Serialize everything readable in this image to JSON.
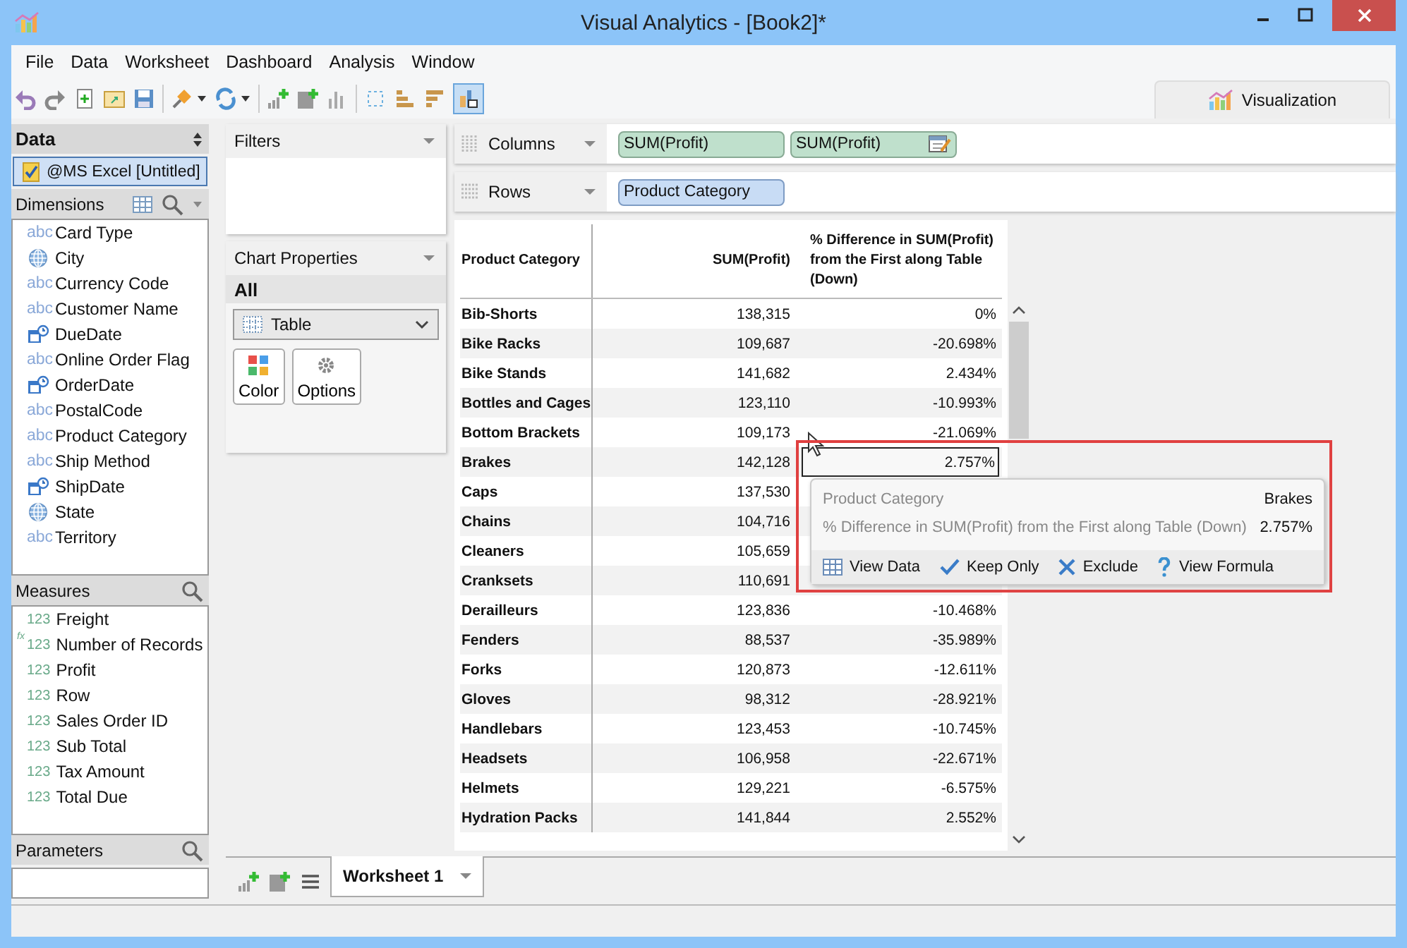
{
  "window": {
    "title": "Visual Analytics - [Book2]*"
  },
  "menu": [
    "File",
    "Data",
    "Worksheet",
    "Dashboard",
    "Analysis",
    "Window"
  ],
  "visualization_tab": {
    "label": "Visualization"
  },
  "data_panel": {
    "title": "Data",
    "source": {
      "label": "@MS Excel [Untitled]",
      "checked": true
    }
  },
  "dimensions": {
    "title": "Dimensions",
    "items": [
      {
        "label": "Card Type",
        "kind": "text",
        "type_text": "abc"
      },
      {
        "label": "City",
        "kind": "geo"
      },
      {
        "label": "Currency Code",
        "kind": "text",
        "type_text": "abc"
      },
      {
        "label": "Customer Name",
        "kind": "text",
        "type_text": "abc"
      },
      {
        "label": "DueDate",
        "kind": "date"
      },
      {
        "label": "Online Order Flag",
        "kind": "text",
        "type_text": "abc"
      },
      {
        "label": "OrderDate",
        "kind": "date"
      },
      {
        "label": "PostalCode",
        "kind": "text",
        "type_text": "abc"
      },
      {
        "label": "Product Category",
        "kind": "text",
        "type_text": "abc"
      },
      {
        "label": "Ship Method",
        "kind": "text",
        "type_text": "abc"
      },
      {
        "label": "ShipDate",
        "kind": "date"
      },
      {
        "label": "State",
        "kind": "geo"
      },
      {
        "label": "Territory",
        "kind": "text",
        "type_text": "abc"
      }
    ]
  },
  "measures": {
    "title": "Measures",
    "items": [
      {
        "label": "Freight",
        "kind": "number",
        "type_text": "123"
      },
      {
        "label": "Number of Records",
        "kind": "calc",
        "type_text": "123",
        "formula_mark": "fx"
      },
      {
        "label": "Profit",
        "kind": "number",
        "type_text": "123"
      },
      {
        "label": "Row",
        "kind": "number",
        "type_text": "123"
      },
      {
        "label": "Sales Order ID",
        "kind": "number",
        "type_text": "123"
      },
      {
        "label": "Sub Total",
        "kind": "number",
        "type_text": "123"
      },
      {
        "label": "Tax Amount",
        "kind": "number",
        "type_text": "123"
      },
      {
        "label": "Total Due",
        "kind": "number",
        "type_text": "123"
      }
    ]
  },
  "parameters": {
    "title": "Parameters"
  },
  "filters": {
    "title": "Filters"
  },
  "chart_properties": {
    "title": "Chart Properties",
    "mark_group": "All",
    "mark_type": "Table",
    "buttons": [
      {
        "label": "Color",
        "kind": "color"
      },
      {
        "label": "Options",
        "kind": "options"
      }
    ]
  },
  "shelves": [
    {
      "label": "Columns",
      "kind": "columns",
      "pills": [
        {
          "label": "SUM(Profit)",
          "kind": "measure",
          "calc": false
        },
        {
          "label": "SUM(Profit)",
          "kind": "measure",
          "calc": true
        }
      ]
    },
    {
      "label": "Rows",
      "kind": "rows",
      "pills": [
        {
          "label": "Product Category",
          "kind": "dimension",
          "calc": false
        }
      ]
    }
  ],
  "table": {
    "columns": [
      "Product Category",
      "SUM(Profit)",
      "% Difference in SUM(Profit) from the First along Table (Down)"
    ],
    "rows": [
      {
        "category": "Bib-Shorts",
        "profit": "138,315",
        "pct": "0%",
        "selected": false
      },
      {
        "category": "Bike Racks",
        "profit": "109,687",
        "pct": "-20.698%",
        "selected": false
      },
      {
        "category": "Bike Stands",
        "profit": "141,682",
        "pct": "2.434%",
        "selected": false
      },
      {
        "category": "Bottles and Cages",
        "profit": "123,110",
        "pct": "-10.993%",
        "selected": false
      },
      {
        "category": "Bottom Brackets",
        "profit": "109,173",
        "pct": "-21.069%",
        "selected": false
      },
      {
        "category": "Brakes",
        "profit": "142,128",
        "pct": "2.757%",
        "selected": true
      },
      {
        "category": "Caps",
        "profit": "137,530",
        "selected": false
      },
      {
        "category": "Chains",
        "profit": "104,716",
        "selected": false
      },
      {
        "category": "Cleaners",
        "profit": "105,659",
        "selected": false
      },
      {
        "category": "Cranksets",
        "profit": "110,691",
        "selected": false
      },
      {
        "category": "Derailleurs",
        "profit": "123,836",
        "pct": "-10.468%",
        "selected": false
      },
      {
        "category": "Fenders",
        "profit": "88,537",
        "pct": "-35.989%",
        "selected": false
      },
      {
        "category": "Forks",
        "profit": "120,873",
        "pct": "-12.611%",
        "selected": false
      },
      {
        "category": "Gloves",
        "profit": "98,312",
        "pct": "-28.921%",
        "selected": false
      },
      {
        "category": "Handlebars",
        "profit": "123,453",
        "pct": "-10.745%",
        "selected": false
      },
      {
        "category": "Headsets",
        "profit": "106,958",
        "pct": "-22.671%",
        "selected": false
      },
      {
        "category": "Helmets",
        "profit": "129,221",
        "pct": "-6.575%",
        "selected": false
      },
      {
        "category": "Hydration Packs",
        "profit": "141,844",
        "pct": "2.552%",
        "selected": false
      }
    ]
  },
  "tooltip": {
    "fields": [
      {
        "name": "Product Category",
        "value": "Brakes"
      },
      {
        "name": "% Difference in SUM(Profit) from the First along Table (Down)",
        "value": "2.757%"
      }
    ],
    "actions": [
      {
        "label": "View Data",
        "kind": "view-data"
      },
      {
        "label": "Keep Only",
        "kind": "keep"
      },
      {
        "label": "Exclude",
        "kind": "exclude"
      },
      {
        "label": "View Formula",
        "kind": "formula"
      }
    ]
  },
  "worksheet_tabs": [
    {
      "label": "Worksheet 1",
      "selected": true
    }
  ]
}
